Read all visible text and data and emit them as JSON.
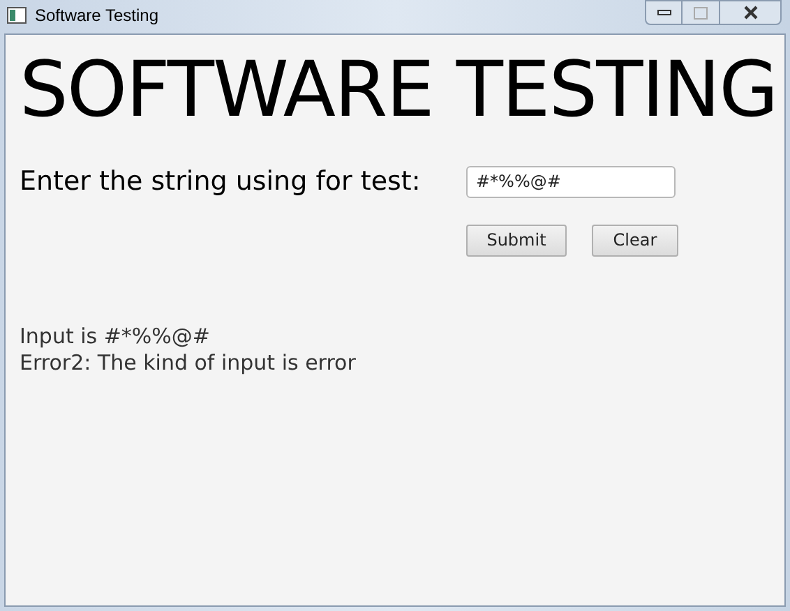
{
  "window": {
    "title": "Software Testing"
  },
  "heading": "SOFTWARE TESTING",
  "prompt": "Enter the string using for test:",
  "input": {
    "value": "#*%%@#"
  },
  "buttons": [
    "Submit",
    "Clear"
  ],
  "output": [
    "Input is #*%%@#",
    "Error2: The kind of input is error"
  ]
}
